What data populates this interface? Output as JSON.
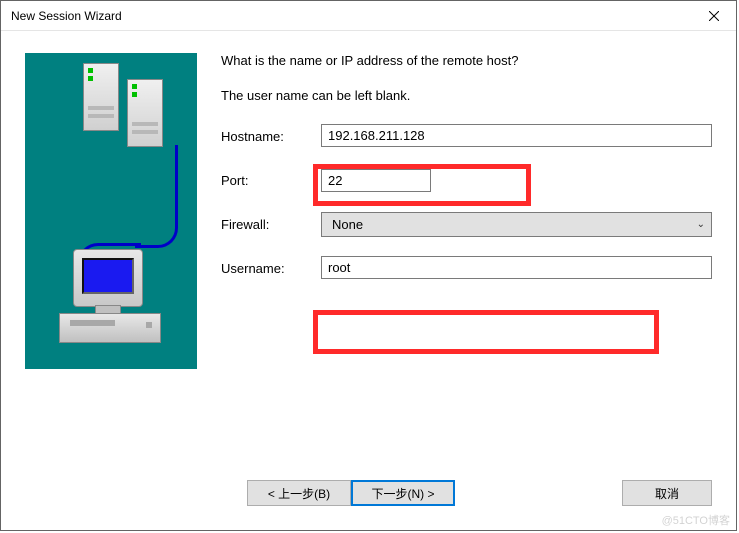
{
  "window": {
    "title": "New Session Wizard"
  },
  "page": {
    "heading": "What is the name or IP address of the remote host?",
    "subheading": "The user name can be left blank."
  },
  "form": {
    "hostname": {
      "label": "Hostname:",
      "value": "192.168.211.128"
    },
    "port": {
      "label": "Port:",
      "value": "22"
    },
    "firewall": {
      "label": "Firewall:",
      "selected": "None"
    },
    "username": {
      "label": "Username:",
      "value": "root"
    }
  },
  "buttons": {
    "back": "< 上一步(B)",
    "next": "下一步(N) >",
    "cancel": "取消"
  },
  "watermark": "@51CTO博客"
}
